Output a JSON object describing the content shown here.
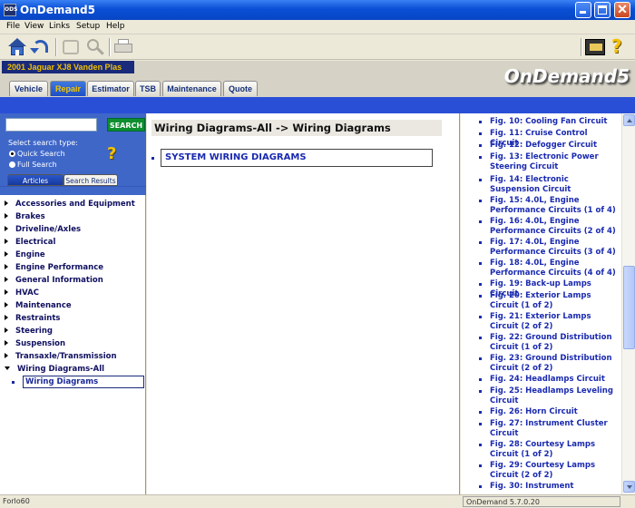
{
  "window": {
    "title": "OnDemand5",
    "app_icon_text": "ODS"
  },
  "menu": [
    "File",
    "View",
    "Links",
    "Setup",
    "Help"
  ],
  "vehicle": "2001 Jaguar XJ8 Vanden Plas",
  "logo": "OnDemand5",
  "tabs": [
    {
      "label": "Vehicle",
      "active": false
    },
    {
      "label": "Repair",
      "active": true
    },
    {
      "label": "Estimator",
      "active": false
    },
    {
      "label": "TSB",
      "active": false
    },
    {
      "label": "Maintenance",
      "active": false
    },
    {
      "label": "Quote",
      "active": false
    }
  ],
  "search": {
    "value": "",
    "button_label": "SEARCH",
    "type_label": "Select search type:",
    "options": [
      {
        "label": "Quick Search",
        "selected": true
      },
      {
        "label": "Full Search",
        "selected": false
      }
    ],
    "help_glyph": "?",
    "subtabs": [
      "Articles",
      "Search Results"
    ]
  },
  "tree": {
    "items": [
      "Accessories and Equipment",
      "Brakes",
      "Driveline/Axles",
      "Electrical",
      "Engine",
      "Engine Performance",
      "General Information",
      "HVAC",
      "Maintenance",
      "Restraints",
      "Steering",
      "Suspension",
      "Transaxle/Transmission",
      "Wiring Diagrams-All"
    ],
    "selected": "Wiring Diagrams"
  },
  "center": {
    "title": "Wiring Diagrams-All -> Wiring Diagrams",
    "items": [
      "SYSTEM WIRING DIAGRAMS"
    ]
  },
  "figures": [
    "Fig. 10: Cooling Fan Circuit",
    "Fig. 11: Cruise Control Circuit",
    "Fig. 12: Defogger Circuit",
    "Fig. 13: Electronic Power Steering Circuit",
    "Fig. 14: Electronic Suspension Circuit",
    "Fig. 15: 4.0L, Engine Performance Circuits (1 of 4)",
    "Fig. 16: 4.0L, Engine Performance Circuits (2 of 4)",
    "Fig. 17: 4.0L, Engine Performance Circuits (3 of 4)",
    "Fig. 18: 4.0L, Engine Performance Circuits (4 of 4)",
    "Fig. 19: Back-up Lamps Circuit",
    "Fig. 20: Exterior Lamps Circuit (1 of 2)",
    "Fig. 21: Exterior Lamps Circuit (2 of 2)",
    "Fig. 22: Ground Distribution Circuit (1 of 2)",
    "Fig. 23: Ground Distribution Circuit (2 of 2)",
    "Fig. 24: Headlamps Circuit",
    "Fig. 25: Headlamps Leveling Circuit",
    "Fig. 26: Horn Circuit",
    "Fig. 27: Instrument Cluster Circuit",
    "Fig. 28: Courtesy Lamps Circuit (1 of 2)",
    "Fig. 29: Courtesy Lamps Circuit (2 of 2)",
    "Fig. 30: Instrument"
  ],
  "status": {
    "left": "Forlo60",
    "right": "OnDemand 5.7.0.20"
  }
}
